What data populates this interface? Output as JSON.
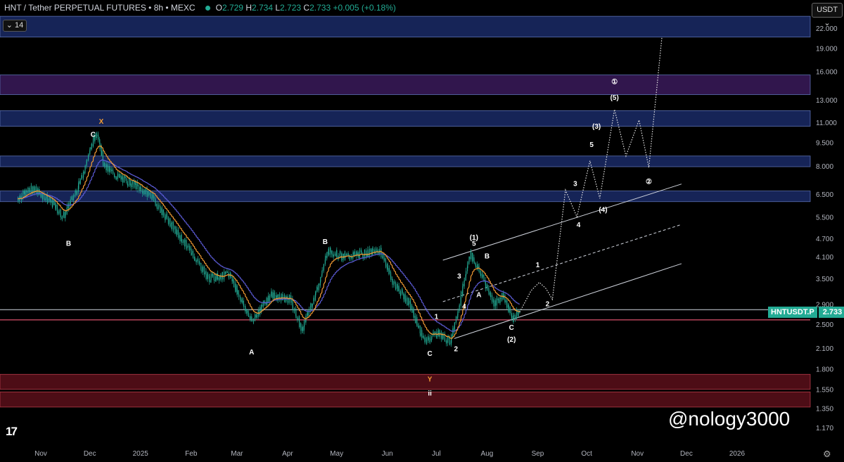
{
  "header": {
    "symbol_title": "HNT / Tether PERPETUAL FUTURES • 8h • MEXC",
    "open_label": "O",
    "open": "2.729",
    "high_label": "H",
    "high": "2.734",
    "low_label": "L",
    "low": "2.723",
    "close_label": "C",
    "close": "2.733",
    "change": "+0.005 (+0.18%)",
    "indicator_count": "14",
    "currency": "USDT"
  },
  "price_tag": {
    "symbol": "HNTUSDT.P",
    "price": "2.733"
  },
  "watermark": "@nology3000",
  "logo": "17",
  "colors": {
    "background": "#000000",
    "candles": "#22ab94",
    "ema_fast": "#f39c34",
    "ema_slow": "#5b5bd6",
    "blue_zone": "#1a2a66",
    "purple_zone": "#3a1a5a",
    "red_zone": "#5a0f1a",
    "white_label": "#ffffff",
    "orange_label": "#f39c34"
  },
  "chart_data": {
    "type": "candlestick",
    "scale": "log",
    "ylim": [
      1.1,
      24
    ],
    "y_ticks": [
      "22.000",
      "19.000",
      "16.000",
      "13.000",
      "11.000",
      "9.500",
      "8.000",
      "6.500",
      "5.500",
      "4.700",
      "4.100",
      "3.500",
      "2.900",
      "2.500",
      "2.100",
      "1.800",
      "1.550",
      "1.350",
      "1.170"
    ],
    "x_ticks": [
      "Nov",
      "Dec",
      "2025",
      "Feb",
      "Mar",
      "Apr",
      "May",
      "Jun",
      "Jul",
      "Aug",
      "Sep",
      "Oct",
      "Nov",
      "Dec",
      "2026"
    ],
    "last_price": 2.733,
    "price_path": [
      [
        "2024-10-18",
        6.3
      ],
      [
        "2024-10-28",
        6.8
      ],
      [
        "2024-11-08",
        6.1
      ],
      [
        "2024-11-15",
        5.5
      ],
      [
        "2024-11-25",
        7.0
      ],
      [
        "2024-12-03",
        9.5
      ],
      [
        "2024-12-06",
        10.3
      ],
      [
        "2024-12-10",
        8.0
      ],
      [
        "2024-12-18",
        7.4
      ],
      [
        "2024-12-28",
        7.0
      ],
      [
        "2025-01-08",
        6.4
      ],
      [
        "2025-01-20",
        5.2
      ],
      [
        "2025-02-02",
        4.2
      ],
      [
        "2025-02-12",
        3.5
      ],
      [
        "2025-02-25",
        3.6
      ],
      [
        "2025-03-10",
        2.55
      ],
      [
        "2025-03-22",
        3.1
      ],
      [
        "2025-04-03",
        3.0
      ],
      [
        "2025-04-10",
        2.4
      ],
      [
        "2025-04-20",
        3.3
      ],
      [
        "2025-04-26",
        4.3
      ],
      [
        "2025-05-06",
        4.1
      ],
      [
        "2025-05-18",
        4.2
      ],
      [
        "2025-05-28",
        4.3
      ],
      [
        "2025-06-05",
        3.4
      ],
      [
        "2025-06-15",
        2.9
      ],
      [
        "2025-06-24",
        2.2
      ],
      [
        "2025-07-02",
        2.35
      ],
      [
        "2025-07-10",
        2.2
      ],
      [
        "2025-07-16",
        3.0
      ],
      [
        "2025-07-22",
        4.2
      ],
      [
        "2025-07-30",
        3.5
      ],
      [
        "2025-08-06",
        2.9
      ],
      [
        "2025-08-11",
        3.1
      ],
      [
        "2025-08-17",
        2.6
      ],
      [
        "2025-08-21",
        2.733
      ]
    ],
    "projection_path": [
      [
        "2025-08-21",
        2.733
      ],
      [
        "2025-08-28",
        3.2
      ],
      [
        "2025-09-02",
        3.4
      ],
      [
        "2025-09-06",
        3.25
      ],
      [
        "2025-09-10",
        3.0
      ],
      [
        "2025-09-18",
        6.7
      ],
      [
        "2025-09-25",
        5.5
      ],
      [
        "2025-10-03",
        8.3
      ],
      [
        "2025-10-09",
        6.3
      ],
      [
        "2025-10-18",
        12.1
      ],
      [
        "2025-10-25",
        8.6
      ],
      [
        "2025-11-02",
        11.2
      ],
      [
        "2025-11-08",
        7.9
      ],
      [
        "2025-11-16",
        20.6
      ]
    ],
    "zones": [
      {
        "color": "blue",
        "range": [
          20.6,
          24.0
        ]
      },
      {
        "color": "purple",
        "range": [
          13.5,
          15.6
        ]
      },
      {
        "color": "blue",
        "range": [
          10.7,
          12.0
        ]
      },
      {
        "color": "blue",
        "range": [
          7.95,
          8.6
        ]
      },
      {
        "color": "blue",
        "range": [
          6.15,
          6.65
        ]
      },
      {
        "color": "red",
        "range": [
          1.55,
          1.73
        ]
      },
      {
        "color": "red",
        "range": [
          1.36,
          1.52
        ]
      }
    ],
    "horizontal_lines": [
      2.78,
      2.58
    ],
    "wave_labels": [
      {
        "text": "X",
        "date": "2024-12-08",
        "price": 10.9,
        "color": "orange"
      },
      {
        "text": "C",
        "date": "2024-12-03",
        "price": 9.9
      },
      {
        "text": "B",
        "date": "2024-11-18",
        "price": 4.45
      },
      {
        "text": "A",
        "date": "2025-03-10",
        "price": 2.0
      },
      {
        "text": "B",
        "date": "2025-04-24",
        "price": 4.5
      },
      {
        "text": "C",
        "date": "2025-06-27",
        "price": 1.98
      },
      {
        "text": "Y",
        "date": "2025-06-27",
        "price": 1.64,
        "color": "orange"
      },
      {
        "text": "ii",
        "date": "2025-06-27",
        "price": 1.48
      },
      {
        "text": "1",
        "date": "2025-07-01",
        "price": 2.6
      },
      {
        "text": "2",
        "date": "2025-07-13",
        "price": 2.05
      },
      {
        "text": "3",
        "date": "2025-07-15",
        "price": 3.5
      },
      {
        "text": "4",
        "date": "2025-07-18",
        "price": 2.8
      },
      {
        "text": "5",
        "date": "2025-07-24",
        "price": 4.45
      },
      {
        "text": "(1)",
        "date": "2025-07-24",
        "price": 4.65
      },
      {
        "text": "A",
        "date": "2025-07-27",
        "price": 3.05
      },
      {
        "text": "B",
        "date": "2025-08-01",
        "price": 4.05
      },
      {
        "text": "C",
        "date": "2025-08-16",
        "price": 2.4
      },
      {
        "text": "(2)",
        "date": "2025-08-16",
        "price": 2.2
      },
      {
        "text": "1",
        "date": "2025-09-01",
        "price": 3.8
      },
      {
        "text": "2",
        "date": "2025-09-07",
        "price": 2.85
      },
      {
        "text": "3",
        "date": "2025-09-24",
        "price": 6.9
      },
      {
        "text": "4",
        "date": "2025-09-26",
        "price": 5.1
      },
      {
        "text": "5",
        "date": "2025-10-04",
        "price": 9.2
      },
      {
        "text": "(3)",
        "date": "2025-10-07",
        "price": 10.5
      },
      {
        "text": "(4)",
        "date": "2025-10-11",
        "price": 5.7
      },
      {
        "text": "(5)",
        "date": "2025-10-18",
        "price": 13.0
      },
      {
        "text": "①",
        "date": "2025-10-18",
        "price": 14.6
      },
      {
        "text": "②",
        "date": "2025-11-08",
        "price": 7.0
      }
    ],
    "channel": {
      "upper": [
        [
          "2025-07-05",
          4.0
        ],
        [
          "2025-11-28",
          7.0
        ]
      ],
      "mid": [
        [
          "2025-07-05",
          2.95
        ],
        [
          "2025-11-28",
          5.2
        ]
      ],
      "lower": [
        [
          "2025-07-12",
          2.25
        ],
        [
          "2025-11-28",
          3.9
        ]
      ]
    }
  }
}
